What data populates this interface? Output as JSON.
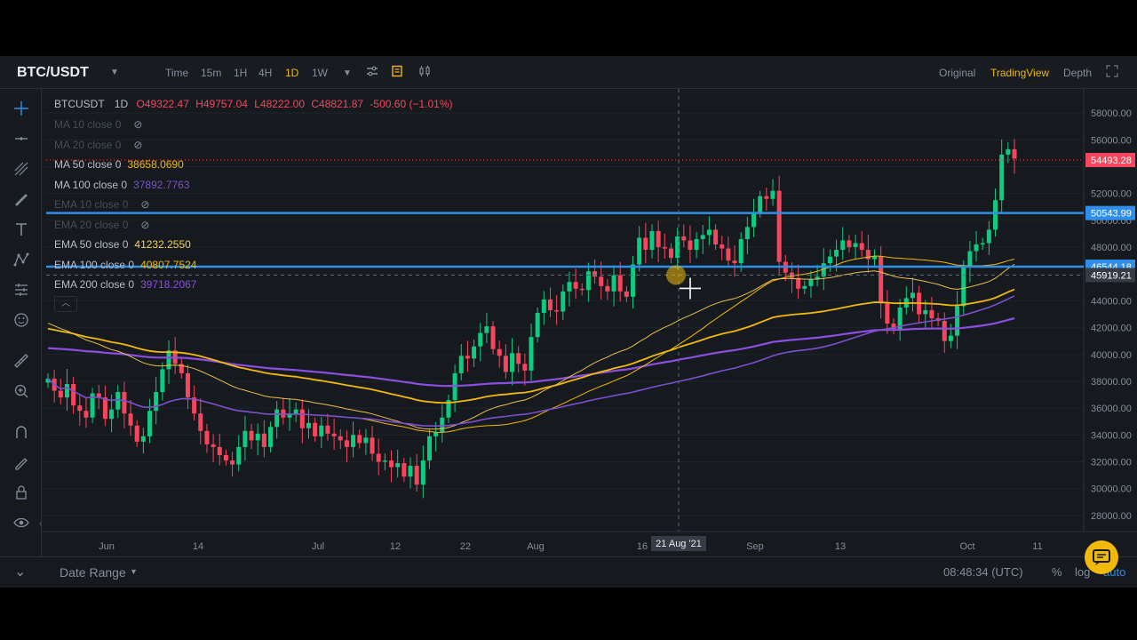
{
  "header": {
    "symbol": "BTC/USDT",
    "timeframes": [
      "Time",
      "15m",
      "1H",
      "4H",
      "1D",
      "1W"
    ],
    "active_timeframe": "1D",
    "views": [
      "Original",
      "TradingView",
      "Depth"
    ],
    "active_view": "TradingView"
  },
  "legend": {
    "ohlc": {
      "pair": "BTCUSDT",
      "interval": "1D",
      "open": "O49322.47",
      "high": "H49757.04",
      "low": "L48222.00",
      "close": "C48821.87",
      "change": "-500.60 (−1.01%)"
    },
    "indicators": [
      {
        "label": "MA 10 close 0",
        "value": "",
        "hidden": true
      },
      {
        "label": "MA 20 close 0",
        "value": "",
        "hidden": true
      },
      {
        "label": "MA 50 close 0",
        "value": "38658.0690",
        "color": "#f0b90b",
        "hidden": false
      },
      {
        "label": "MA 100 close 0",
        "value": "37892.7763",
        "color": "#7b4fcf",
        "hidden": false
      },
      {
        "label": "EMA 10 close 0",
        "value": "",
        "hidden": true
      },
      {
        "label": "EMA 20 close 0",
        "value": "",
        "hidden": true
      },
      {
        "label": "EMA 50 close 0",
        "value": "41232.2550",
        "color": "#f0d060",
        "hidden": false
      },
      {
        "label": "EMA 100 close 0",
        "value": "40807.7524",
        "color": "#f0b90b",
        "hidden": false
      },
      {
        "label": "EMA 200 close 0",
        "value": "39718.2067",
        "color": "#8a4fe0",
        "hidden": false
      }
    ]
  },
  "price_axis": {
    "ticks": [
      "58000.00",
      "56000.00",
      "52000.00",
      "50000.00",
      "48000.00",
      "44000.00",
      "42000.00",
      "40000.00",
      "38000.00",
      "36000.00",
      "34000.00",
      "32000.00",
      "30000.00",
      "28000.00"
    ],
    "last_price": "54493.28",
    "hline_1": "50543.99",
    "hline_2": "46544.18",
    "crosshair_price": "45919.21"
  },
  "time_axis": {
    "labels": [
      "Jun",
      "14",
      "Jul",
      "12",
      "22",
      "Aug",
      "16",
      "Sep",
      "13",
      "Oct",
      "11"
    ],
    "crosshair_date": "21 Aug '21"
  },
  "footer": {
    "date_range": "Date Range",
    "clock": "08:48:34 (UTC)",
    "percent": "%",
    "log": "log",
    "auto": "auto"
  },
  "colors": {
    "up": "#0ecb81",
    "down": "#f6465d",
    "accent": "#f0b90b",
    "hline": "#2f8fe8",
    "ma50": "#f0b90b",
    "ma100": "#7b4fcf",
    "ema50": "#e8c050",
    "ema100": "#f0b90b",
    "ema200": "#8a4fe0"
  },
  "chart_data": {
    "type": "candlestick",
    "ylim": [
      27000,
      59000
    ],
    "x_labels": [
      "Jun",
      "14",
      "Jul",
      "12",
      "22",
      "Aug",
      "16",
      "Sep",
      "13",
      "Oct",
      "11"
    ],
    "closes": [
      38200,
      37300,
      36800,
      37800,
      36200,
      35800,
      35300,
      37100,
      36800,
      35200,
      35900,
      37200,
      35600,
      34700,
      33500,
      33900,
      35800,
      37200,
      38900,
      40300,
      39300,
      38600,
      36800,
      35600,
      34300,
      33300,
      33100,
      32500,
      32100,
      31800,
      33100,
      34300,
      33600,
      34100,
      33100,
      34600,
      35900,
      35300,
      35600,
      35900,
      34500,
      34900,
      33900,
      34700,
      34100,
      33900,
      33600,
      33100,
      34000,
      33400,
      33800,
      32600,
      32000,
      32100,
      31600,
      31900,
      30900,
      31700,
      30300,
      32100,
      33900,
      34200,
      35300,
      36600,
      38600,
      39900,
      39700,
      40600,
      41600,
      42100,
      40400,
      39900,
      38700,
      40100,
      39300,
      38800,
      41300,
      43100,
      44100,
      43300,
      43200,
      44700,
      45400,
      44900,
      44800,
      46200,
      45800,
      45100,
      44700,
      45900,
      44700,
      44300,
      46700,
      48700,
      47800,
      49200,
      48000,
      47900,
      47200,
      48800,
      48500,
      47800,
      48600,
      48900,
      49300,
      48200,
      47900,
      47000,
      46800,
      48600,
      49500,
      50600,
      51800,
      51600,
      52200,
      46900,
      46100,
      45700,
      44900,
      45100,
      45600,
      45800,
      46800,
      47300,
      47800,
      48500,
      48000,
      48300,
      47800,
      47100,
      47300,
      43800,
      42300,
      41900,
      43500,
      44200,
      44600,
      43000,
      43300,
      42700,
      42500,
      41000,
      41400,
      43600,
      46500,
      47700,
      48200,
      48300,
      49300,
      51500,
      54900,
      55300,
      54600
    ]
  }
}
